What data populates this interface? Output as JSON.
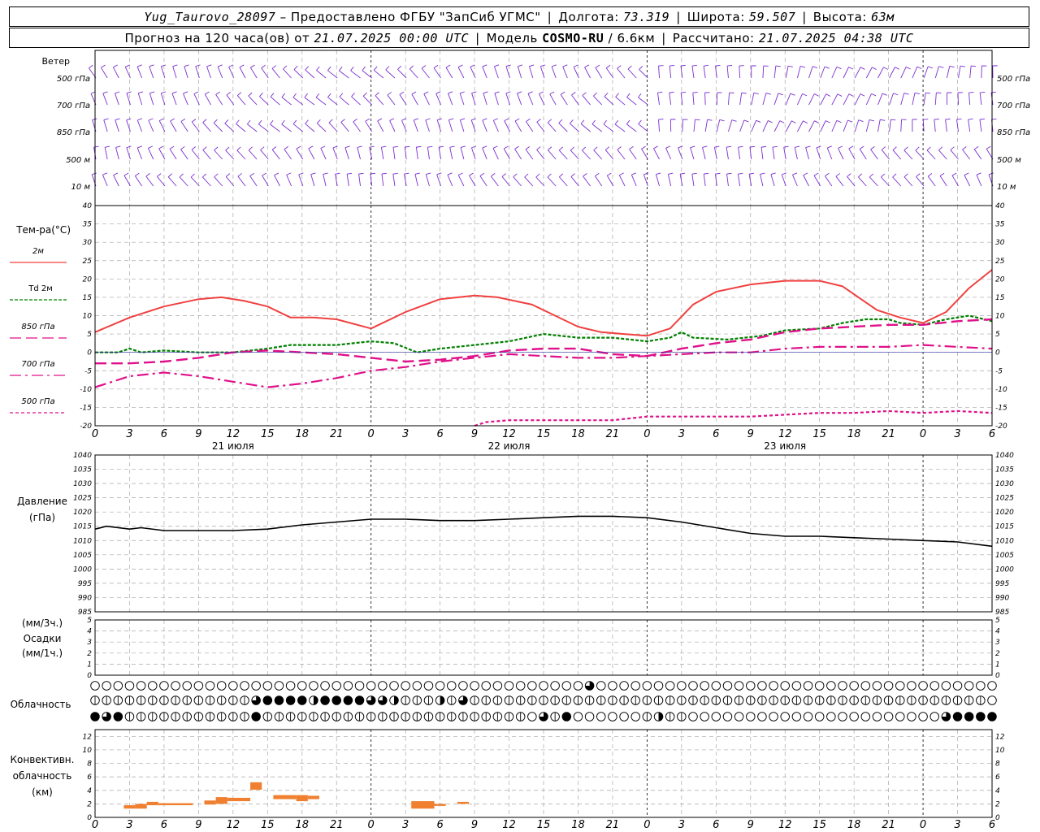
{
  "header": {
    "station": "Yug_Taurovo_28097",
    "provider": "– Предоставлено ФГБУ \"ЗапСиб УГМС\"",
    "lon_label": "Долгота:",
    "lon_value": "73.319",
    "lat_label": "Широта:",
    "lat_value": "59.507",
    "alt_label": "Высота:",
    "alt_value": "63м",
    "forecast_prefix": "Прогноз на 120 часа(ов) от",
    "forecast_start": "21.07.2025 00:00 UTC",
    "model_label": "Модель",
    "model_name": "COSMO-RU",
    "model_res": "/ 6.6км",
    "computed_label": "Рассчитано:",
    "computed_value": "21.07.2025 04:38 UTC"
  },
  "labels": {
    "wind": "Ветер",
    "temp_title": "Тем-ра(°C)",
    "pressure_title_1": "Давление",
    "pressure_title_2": "(гПа)",
    "precip_1": "(мм/3ч.)",
    "precip_2": "Осадки",
    "precip_3": "(мм/1ч.)",
    "cloud": "Облачность",
    "conv_1": "Конвективн.",
    "conv_2": "облачность",
    "conv_3": "(км)"
  },
  "colors": {
    "t2m": "#f04040",
    "td2m": "#008000",
    "t850": "#e0108a",
    "t700": "#e0108a",
    "t500": "#e0108a",
    "wind": "#7a2fd0",
    "pressure": "#000000",
    "convective": "#f08030",
    "grid": "#a8a8a8"
  },
  "chart_data": [
    {
      "type": "wind_barbs",
      "levels": [
        "500 гПа",
        "700 гПа",
        "850 гПа",
        "500 м",
        "10 м"
      ],
      "x_unit": "hours since 21.07.2025 00:00 UTC",
      "x_range": [
        0,
        78
      ],
      "step_hours": 1
    },
    {
      "type": "line",
      "title": "Тем-ра(°C)",
      "ylim": [
        -20,
        40
      ],
      "yticks": [
        -20,
        -15,
        -10,
        -5,
        0,
        5,
        10,
        15,
        20,
        25,
        30,
        35,
        40
      ],
      "x_ticks": [
        "0",
        "3",
        "6",
        "9",
        "12",
        "15",
        "18",
        "21",
        "0",
        "3",
        "6",
        "9",
        "12",
        "15",
        "18",
        "21",
        "0",
        "3",
        "6",
        "9",
        "12",
        "15",
        "18",
        "21",
        "0",
        "3",
        "6"
      ],
      "day_labels": [
        "21 июля",
        "22 июля",
        "23 июля"
      ],
      "series": [
        {
          "name": "2м",
          "x": [
            0,
            3,
            6,
            9,
            11,
            13,
            15,
            17,
            19,
            21,
            24,
            27,
            30,
            33,
            35,
            38,
            40,
            42,
            44,
            46,
            48,
            50,
            52,
            54,
            57,
            60,
            63,
            65,
            68,
            70,
            72,
            74,
            76,
            78
          ],
          "values": [
            5.5,
            9.5,
            12.5,
            14.5,
            15,
            14,
            12.5,
            9.5,
            9.5,
            9,
            6.5,
            11,
            14.5,
            15.5,
            15,
            13,
            10,
            7,
            5.5,
            5,
            4.5,
            6.5,
            13,
            16.5,
            18.5,
            19.5,
            19.5,
            18,
            11.5,
            9.5,
            8,
            11,
            17.5,
            22.5
          ]
        },
        {
          "name": "Td 2м",
          "x": [
            0,
            2,
            3,
            4,
            6,
            9,
            12,
            15,
            17,
            19,
            21,
            24,
            26,
            28,
            30,
            33,
            36,
            39,
            42,
            45,
            48,
            50,
            51,
            52,
            55,
            58,
            60,
            63,
            65,
            67,
            69,
            70,
            72,
            74,
            76,
            78
          ],
          "values": [
            0,
            0,
            1,
            0,
            0.5,
            0,
            0,
            1,
            2,
            2,
            2,
            3,
            2.5,
            0,
            1,
            2,
            3,
            5,
            4,
            4,
            3,
            4,
            5.5,
            4,
            3.5,
            4.5,
            6,
            6.5,
            8,
            9,
            9,
            8,
            7.5,
            9,
            10,
            8.5
          ]
        },
        {
          "name": "850 гПа",
          "x": [
            0,
            3,
            6,
            9,
            12,
            15,
            18,
            21,
            24,
            27,
            30,
            33,
            36,
            39,
            42,
            45,
            48,
            51,
            54,
            57,
            60,
            63,
            66,
            69,
            72,
            75,
            78
          ],
          "values": [
            -3,
            -3,
            -2.5,
            -1.5,
            0,
            0.5,
            0,
            -0.5,
            -1.5,
            -2.5,
            -2,
            -1,
            0.5,
            1,
            1,
            -0.5,
            -1,
            1,
            2.5,
            3.5,
            5.5,
            6.5,
            7,
            7.5,
            7.5,
            8.5,
            9
          ]
        },
        {
          "name": "700 гПа",
          "x": [
            0,
            3,
            6,
            9,
            12,
            15,
            18,
            21,
            24,
            27,
            30,
            33,
            36,
            39,
            42,
            45,
            48,
            51,
            54,
            57,
            60,
            63,
            66,
            69,
            72,
            75,
            78
          ],
          "values": [
            -9.5,
            -6.5,
            -5.5,
            -6.5,
            -8,
            -9.5,
            -8.5,
            -7,
            -5,
            -4,
            -2.5,
            -1.5,
            -0.5,
            -1,
            -1.5,
            -1.5,
            -1,
            -0.5,
            0,
            0,
            1,
            1.5,
            1.5,
            1.5,
            2,
            1.5,
            1
          ]
        },
        {
          "name": "500 гПа",
          "x": [
            33,
            34,
            36,
            39,
            42,
            45,
            48,
            51,
            54,
            57,
            60,
            63,
            66,
            69,
            72,
            75,
            78
          ],
          "values": [
            -20,
            -19,
            -18.5,
            -18.5,
            -18.5,
            -18.5,
            -17.5,
            -17.5,
            -17.5,
            -17.5,
            -17,
            -16.5,
            -16.5,
            -16,
            -16.5,
            -16,
            -16.5
          ]
        }
      ]
    },
    {
      "type": "line",
      "title": "Давление (гПа)",
      "ylim": [
        985,
        1040
      ],
      "yticks": [
        985,
        990,
        995,
        1000,
        1005,
        1010,
        1015,
        1020,
        1025,
        1030,
        1035,
        1040
      ],
      "series": [
        {
          "name": "",
          "x": [
            0,
            1,
            3,
            4,
            6,
            9,
            12,
            15,
            18,
            21,
            24,
            27,
            30,
            33,
            36,
            39,
            42,
            45,
            48,
            51,
            54,
            57,
            60,
            63,
            66,
            69,
            72,
            75,
            78
          ],
          "values": [
            1014,
            1015,
            1014,
            1014.5,
            1013.5,
            1013.5,
            1013.5,
            1014,
            1015.5,
            1016.5,
            1017.5,
            1017.5,
            1017,
            1017,
            1017.5,
            1018,
            1018.5,
            1018.5,
            1018,
            1016.5,
            1014.5,
            1012.5,
            1011.5,
            1011.5,
            1011,
            1010.5,
            1010,
            1009.5,
            1008
          ]
        }
      ]
    },
    {
      "type": "bar",
      "title": "Осадки",
      "ylim": [
        0,
        5
      ],
      "yticks": [
        0,
        1,
        2,
        3,
        4,
        5
      ],
      "values": []
    },
    {
      "type": "heatmap",
      "title": "Облачность",
      "rows": [
        {
          "level": "upper",
          "cover": "000000000000000000000000000000000000000000030000000000000000000000000000000000"
        },
        {
          "level": "middle",
          "cover": "111111111111113444424444332111213111111111111111111111111111111111111111111111"
        },
        {
          "level": "lower",
          "cover": "434111111111114111111111111111111111110314000000121100000000000000000000003444400000"
        }
      ]
    },
    {
      "type": "bar",
      "title": "Конвективн. облачность (км)",
      "ylim": [
        0,
        13
      ],
      "yticks": [
        0,
        2,
        4,
        6,
        8,
        10,
        12
      ],
      "bars": [
        {
          "x0": 2.5,
          "x1": 3.5,
          "bottom": 1.3,
          "top": 1.8
        },
        {
          "x0": 3.5,
          "x1": 4.5,
          "bottom": 1.3,
          "top": 2.0
        },
        {
          "x0": 4.5,
          "x1": 5.5,
          "bottom": 1.8,
          "top": 2.3
        },
        {
          "x0": 5.5,
          "x1": 8.5,
          "bottom": 1.8,
          "top": 2.1
        },
        {
          "x0": 9.5,
          "x1": 10.5,
          "bottom": 1.9,
          "top": 2.5
        },
        {
          "x0": 10.5,
          "x1": 11.5,
          "bottom": 2.0,
          "top": 3.0
        },
        {
          "x0": 11.5,
          "x1": 13.5,
          "bottom": 2.4,
          "top": 2.9
        },
        {
          "x0": 13.5,
          "x1": 14.5,
          "bottom": 4.1,
          "top": 5.2
        },
        {
          "x0": 15.5,
          "x1": 17.5,
          "bottom": 2.7,
          "top": 3.3
        },
        {
          "x0": 17.5,
          "x1": 18.5,
          "bottom": 2.4,
          "top": 3.3
        },
        {
          "x0": 18.5,
          "x1": 19.5,
          "bottom": 2.7,
          "top": 3.2
        },
        {
          "x0": 27.5,
          "x1": 29.5,
          "bottom": 1.3,
          "top": 2.4
        },
        {
          "x0": 29.5,
          "x1": 30.5,
          "bottom": 1.7,
          "top": 2.0
        },
        {
          "x0": 31.5,
          "x1": 32.5,
          "bottom": 2.0,
          "top": 2.3
        }
      ]
    }
  ]
}
